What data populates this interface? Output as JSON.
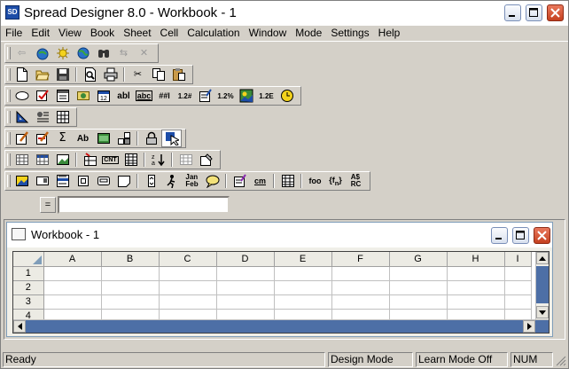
{
  "app": {
    "title": "Spread Designer 8.0 - Workbook - 1",
    "icon_text": "SD"
  },
  "menu": [
    "File",
    "Edit",
    "View",
    "Book",
    "Sheet",
    "Cell",
    "Calculation",
    "Window",
    "Mode",
    "Settings",
    "Help"
  ],
  "toolbar_text": {
    "abl": "abl",
    "abc": "abc",
    "hash": "##l",
    "num12": "1.2#",
    "pct": "1.2%",
    "exp": "1.2E",
    "sigma": "Σ",
    "ab": "Ab",
    "cnt": "CNT",
    "jan": "Jan",
    "feb": "Feb",
    "foo": "foo",
    "fn": "{f",
    "fn_sub": "n",
    "cm": "cm",
    "abrc_top": "A$",
    "abrc_bottom": "RC"
  },
  "formula": {
    "label": "=",
    "value": ""
  },
  "workbook": {
    "title": "Workbook - 1",
    "columns": [
      "A",
      "B",
      "C",
      "D",
      "E",
      "F",
      "G",
      "H",
      "I"
    ],
    "rows": [
      "1",
      "2",
      "3",
      "4"
    ]
  },
  "status": {
    "message": "Ready",
    "mode": "Design Mode",
    "learn": "Learn Mode Off",
    "num": "NUM"
  }
}
